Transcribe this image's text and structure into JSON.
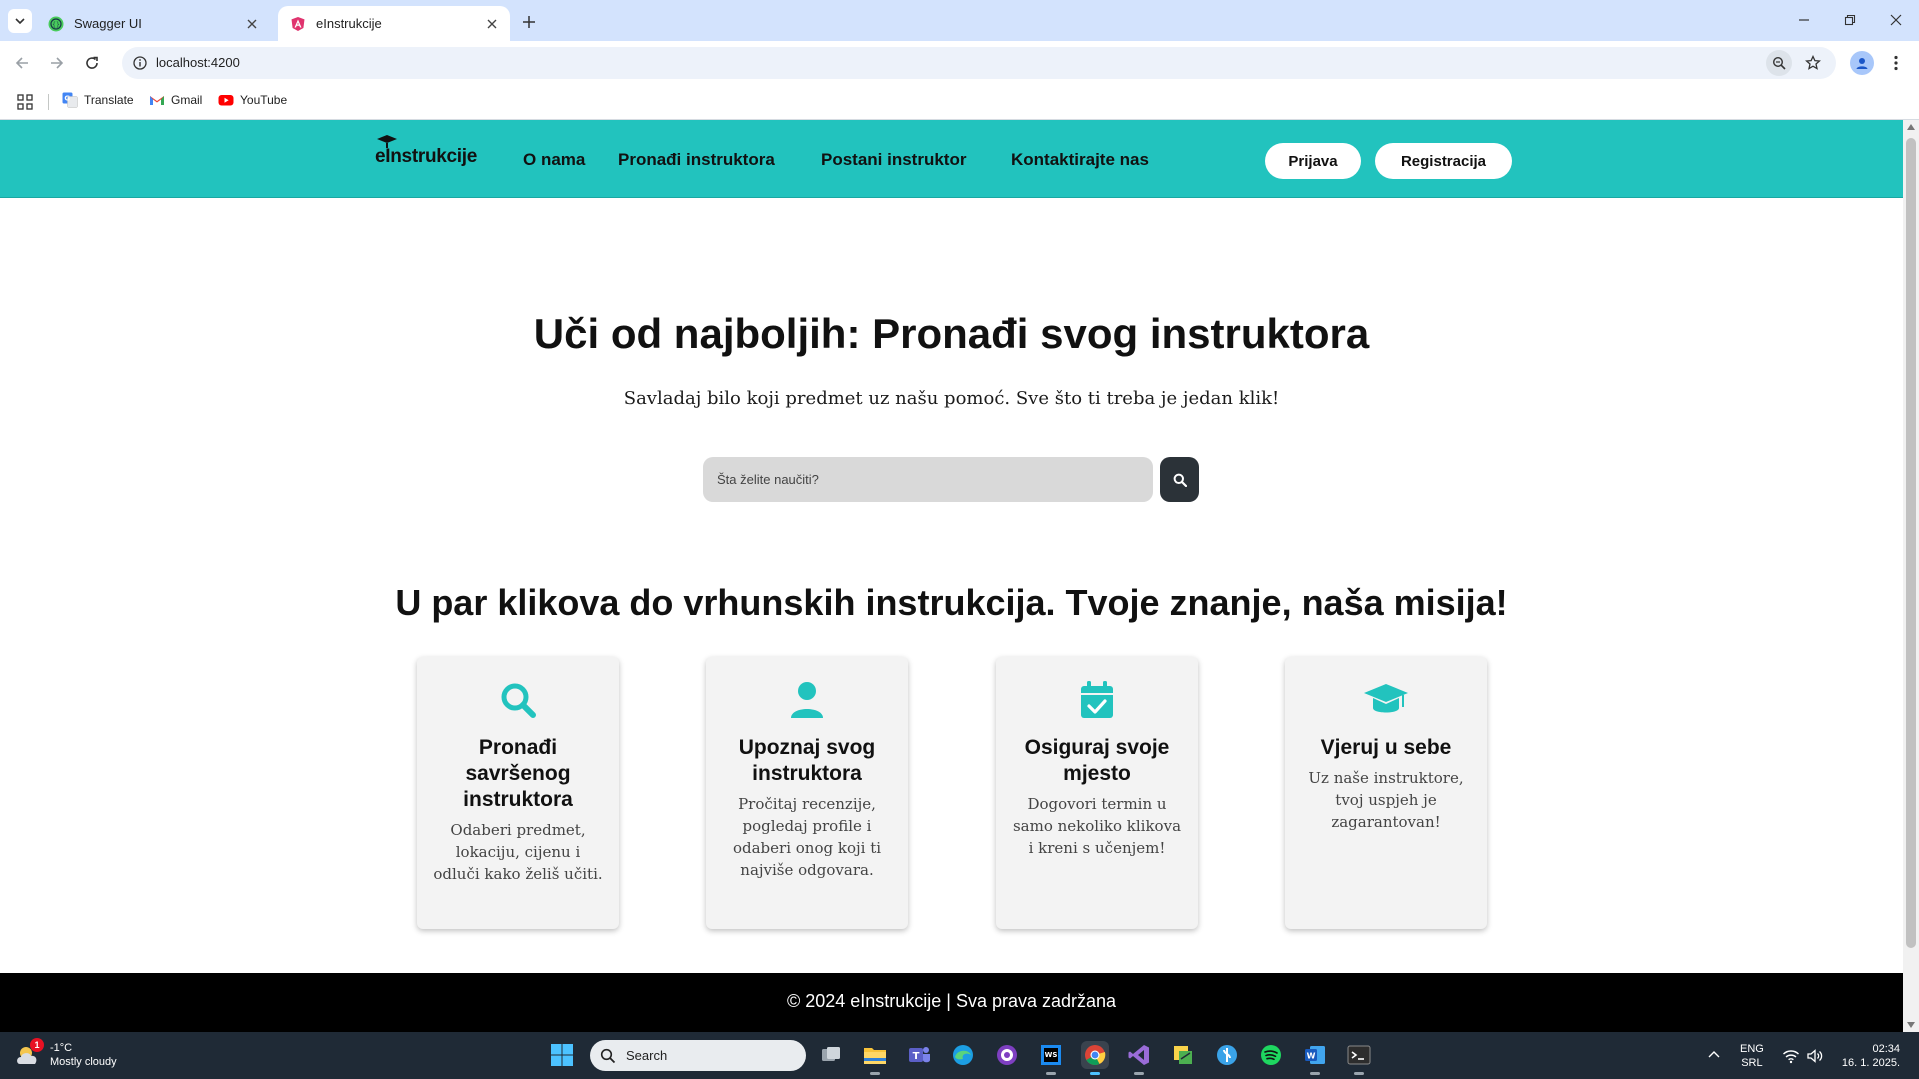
{
  "browser": {
    "tabs": [
      {
        "title": "Swagger UI",
        "active": false
      },
      {
        "title": "eInstrukcije",
        "active": true
      }
    ],
    "url": "localhost:4200",
    "bookmarks": [
      {
        "label": "Translate",
        "icon": "google-translate-icon"
      },
      {
        "label": "Gmail",
        "icon": "gmail-icon"
      },
      {
        "label": "YouTube",
        "icon": "youtube-icon"
      }
    ]
  },
  "site": {
    "logo": "eInstrukcije",
    "nav": [
      "O nama",
      "Pronađi instruktora",
      "Postani instruktor",
      "Kontaktirajte nas"
    ],
    "login_label": "Prijava",
    "register_label": "Registracija",
    "accent_color": "#22c3be"
  },
  "hero": {
    "title": "Uči od najboljih: Pronađi svog instruktora",
    "subtitle": "Savladaj bilo koji predmet uz našu pomoć. Sve što ti treba je jedan klik!",
    "search_placeholder": "Šta želite naučiti?"
  },
  "features": {
    "heading": "U par klikova do vrhunskih instrukcija. Tvoje znanje, naša misija!",
    "cards": [
      {
        "icon": "search-icon",
        "title": "Pronađi savršenog instruktora",
        "text": "Odaberi predmet, lokaciju, cijenu i odluči kako želiš učiti."
      },
      {
        "icon": "user-icon",
        "title": "Upoznaj svog instruktora",
        "text": "Pročitaj recenzije, pogledaj profile i odaberi onog koji ti najviše odgovara."
      },
      {
        "icon": "calendar-check-icon",
        "title": "Osiguraj svoje mjesto",
        "text": "Dogovori termin u samo nekoliko klikova i kreni s učenjem!"
      },
      {
        "icon": "graduation-cap-icon",
        "title": "Vjeruj u sebe",
        "text": "Uz naše instruktore, tvoj uspjeh je zagarantovan!"
      }
    ]
  },
  "footer": {
    "text": "© 2024 eInstrukcije | Sva prava zadržana"
  },
  "taskbar": {
    "weather_badge": "1",
    "weather_temp": "-1°C",
    "weather_desc": "Mostly cloudy",
    "search_label": "Search",
    "lang_top": "ENG",
    "lang_bottom": "SRL",
    "time": "02:34",
    "date": "16. 1. 2025."
  }
}
